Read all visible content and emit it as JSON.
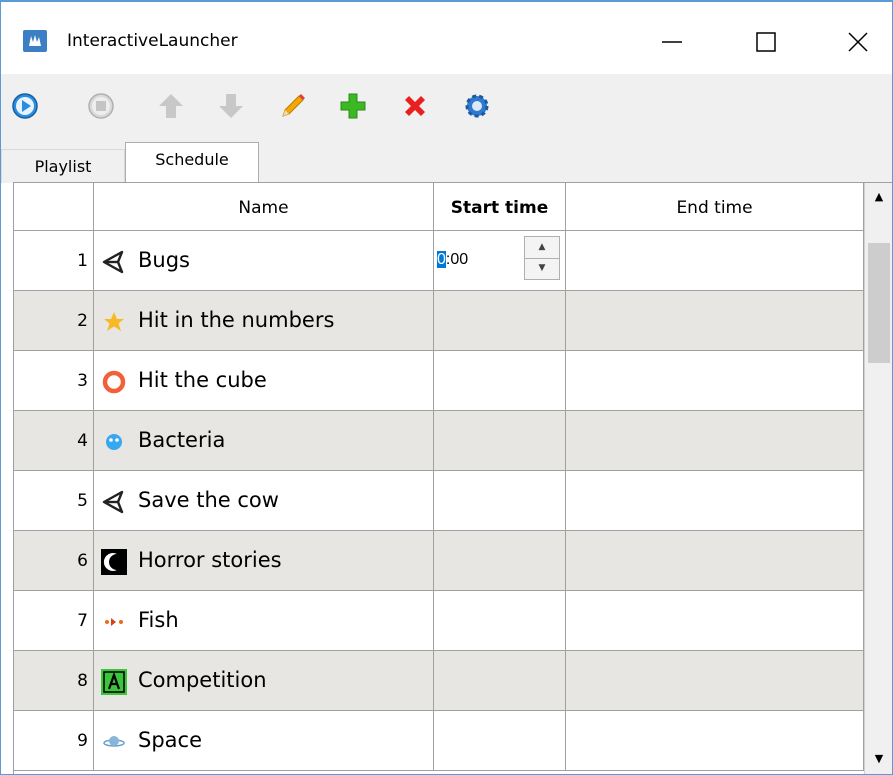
{
  "window": {
    "title": "InteractiveLauncher"
  },
  "title_controls": {
    "minimize": "minimize-icon",
    "maximize": "maximize-icon",
    "close": "close-icon"
  },
  "toolbar": [
    "play-icon",
    "stop-icon",
    "move-up-icon",
    "move-down-icon",
    "edit-pencil-icon",
    "add-plus-icon",
    "delete-x-icon",
    "settings-gear-icon"
  ],
  "tabs": [
    {
      "label": "Playlist"
    },
    {
      "label": "Schedule"
    }
  ],
  "table": {
    "columns": [
      "Name",
      "Start time",
      "End time"
    ],
    "rows": [
      {
        "num": "1",
        "name": "Bugs",
        "icon": "unity-icon",
        "start": "0:00",
        "end": ""
      },
      {
        "num": "2",
        "name": "Hit in the numbers",
        "icon": "star-icon",
        "start": "",
        "end": ""
      },
      {
        "num": "3",
        "name": "Hit the cube",
        "icon": "ring-icon",
        "start": "",
        "end": ""
      },
      {
        "num": "4",
        "name": "Bacteria",
        "icon": "bacteria-icon",
        "start": "",
        "end": ""
      },
      {
        "num": "5",
        "name": "Save the cow",
        "icon": "unity-icon",
        "start": "",
        "end": ""
      },
      {
        "num": "6",
        "name": "Horror stories",
        "icon": "moon-icon",
        "start": "",
        "end": ""
      },
      {
        "num": "7",
        "name": "Fish",
        "icon": "fish-icon",
        "start": "",
        "end": ""
      },
      {
        "num": "8",
        "name": "Competition",
        "icon": "letter-a-icon",
        "start": "",
        "end": ""
      },
      {
        "num": "9",
        "name": "Space",
        "icon": "planet-icon",
        "start": "",
        "end": ""
      }
    ],
    "editor": {
      "caret": "0",
      "rest": ":00"
    }
  },
  "colors": {
    "accent": "#0078d7",
    "alt_row": "#e8e6e3",
    "border": "#a0a0a0"
  }
}
